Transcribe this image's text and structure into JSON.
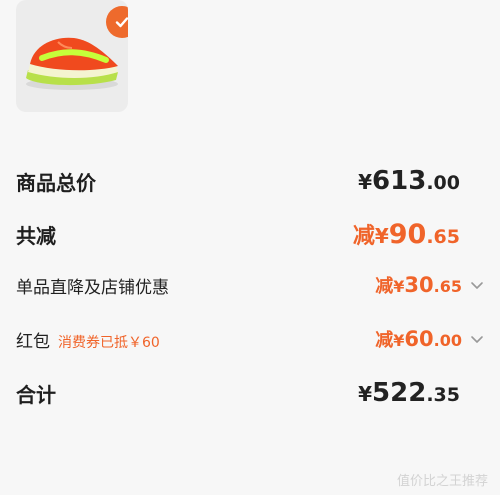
{
  "product": {
    "image": "orange-green-running-shoe",
    "selected": true
  },
  "summary": {
    "total_label": "商品总价",
    "total_yen": "¥",
    "total_int": "613",
    "total_dec": ".00",
    "reduction_label": "共减",
    "reduction_prefix": "减",
    "reduction_yen": "¥",
    "reduction_int": "90",
    "reduction_dec": ".65"
  },
  "discounts": [
    {
      "label": "单品直降及店铺优惠",
      "note": "",
      "prefix": "减",
      "yen": "¥",
      "int": "30",
      "dec": ".65"
    },
    {
      "label": "红包",
      "note": "消费券已抵￥60",
      "prefix": "减",
      "yen": "¥",
      "int": "60",
      "dec": ".00"
    }
  ],
  "final": {
    "label": "合计",
    "yen": "¥",
    "int": "522",
    "dec": ".35"
  },
  "watermark": "值价比之王推荐",
  "colors": {
    "accent": "#f0642a",
    "badge": "#ee6a2c",
    "background": "#f7f7f7"
  }
}
